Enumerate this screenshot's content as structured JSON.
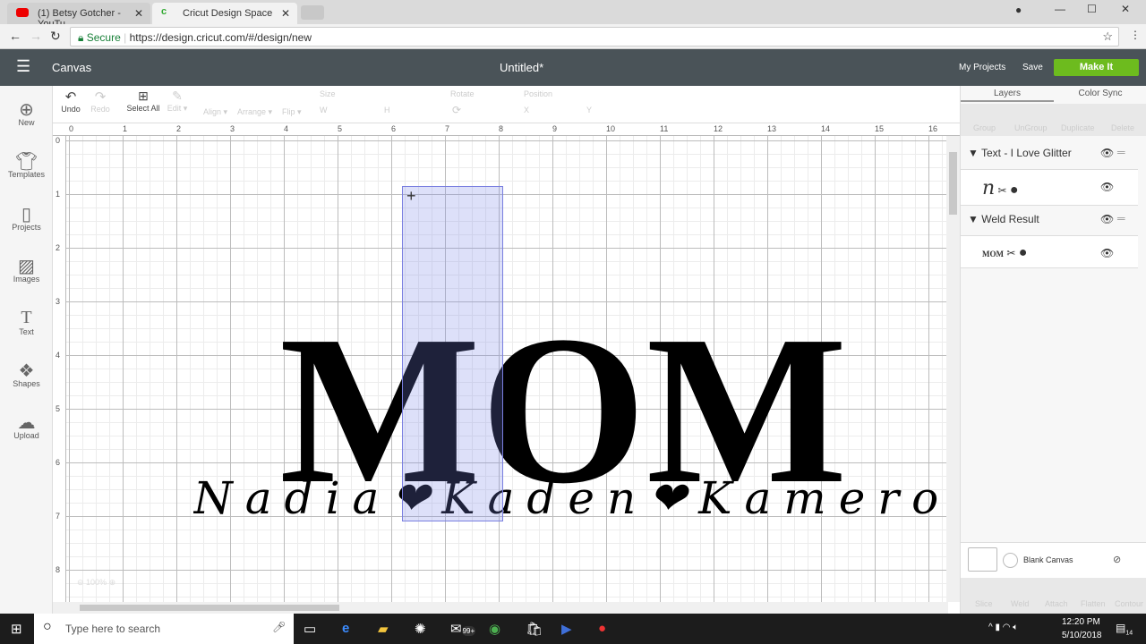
{
  "browser": {
    "tabs": [
      {
        "title": "(1) Betsy Gotcher - YouTu",
        "icon": "youtube-icon"
      },
      {
        "title": "Cricut Design Space",
        "icon": "cricut-icon"
      }
    ],
    "secure_label": "Secure",
    "url": "https://design.cricut.com/#/design/new"
  },
  "app": {
    "section": "Canvas",
    "title": "Untitled*",
    "my_projects": "My Projects",
    "save": "Save",
    "make_it": "Make It",
    "accent": "#6dbb1e"
  },
  "nav": [
    {
      "label": "New",
      "icon": "plus-circle-icon"
    },
    {
      "label": "Templates",
      "icon": "tshirt-icon"
    },
    {
      "label": "Projects",
      "icon": "book-icon"
    },
    {
      "label": "Images",
      "icon": "image-icon"
    },
    {
      "label": "Text",
      "icon": "text-icon"
    },
    {
      "label": "Shapes",
      "icon": "shapes-icon"
    },
    {
      "label": "Upload",
      "icon": "upload-icon"
    }
  ],
  "toolbar": {
    "undo": "Undo",
    "redo": "Redo",
    "select_all": "Select All",
    "edit": "Edit ▾",
    "align": "Align ▾",
    "arrange": "Arrange ▾",
    "flip": "Flip ▾",
    "size": "Size",
    "w": "W",
    "h": "H",
    "rotate": "Rotate",
    "position": "Position",
    "x": "X",
    "y": "Y"
  },
  "ruler": {
    "h": [
      "0",
      "1",
      "2",
      "3",
      "4",
      "5",
      "6",
      "7",
      "8",
      "9",
      "10",
      "11",
      "12",
      "13",
      "14",
      "15",
      "16"
    ],
    "v": [
      "0",
      "1",
      "2",
      "3",
      "4",
      "5",
      "6",
      "7",
      "8"
    ]
  },
  "canvas": {
    "mom": "MOM",
    "names": "Nadia❤Kaden❤Kameron",
    "zoom": "100%"
  },
  "panel": {
    "tabs": [
      "Layers",
      "Color Sync"
    ],
    "actions": [
      "Group",
      "UnGroup",
      "Duplicate",
      "Delete"
    ],
    "layers": [
      {
        "name": "Text - I Love Glitter",
        "thumb": "n"
      },
      {
        "name": "Weld Result",
        "thumb": "MOM"
      }
    ],
    "blank_canvas": "Blank Canvas",
    "bottom": [
      "Slice",
      "Weld",
      "Attach",
      "Flatten",
      "Contour"
    ]
  },
  "taskbar": {
    "search": "Type here to search",
    "time": "12:20 PM",
    "date": "5/10/2018",
    "badge": "99+",
    "notif": "14"
  }
}
